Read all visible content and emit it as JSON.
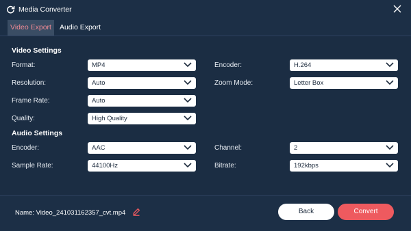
{
  "window": {
    "title": "Media Converter",
    "app_icon": "refresh-icon",
    "close_icon": "close-icon"
  },
  "tabs": [
    {
      "label": "Video Export",
      "active": true
    },
    {
      "label": "Audio Export",
      "active": false
    }
  ],
  "video_settings": {
    "heading": "Video Settings",
    "format": {
      "label": "Format:",
      "value": "MP4"
    },
    "encoder": {
      "label": "Encoder:",
      "value": "H.264"
    },
    "resolution": {
      "label": "Resolution:",
      "value": "Auto"
    },
    "zoom_mode": {
      "label": "Zoom Mode:",
      "value": "Letter Box"
    },
    "frame_rate": {
      "label": "Frame Rate:",
      "value": "Auto"
    },
    "quality": {
      "label": "Quality:",
      "value": "High Quality"
    }
  },
  "audio_settings": {
    "heading": "Audio Settings",
    "encoder": {
      "label": "Encoder:",
      "value": "AAC"
    },
    "channel": {
      "label": "Channel:",
      "value": "2"
    },
    "sample_rate": {
      "label": "Sample Rate:",
      "value": "44100Hz"
    },
    "bitrate": {
      "label": "Bitrate:",
      "value": "192kbps"
    }
  },
  "footer": {
    "name": "Name: Video_241031162357_cvt.mp4",
    "edit_icon": "pencil-icon",
    "back_label": "Back",
    "convert_label": "Convert"
  },
  "colors": {
    "background": "#1c2f46",
    "active_tab_text": "#f08a95",
    "convert_button": "#ee5a5f",
    "edit_icon": "#ee5a5f"
  }
}
